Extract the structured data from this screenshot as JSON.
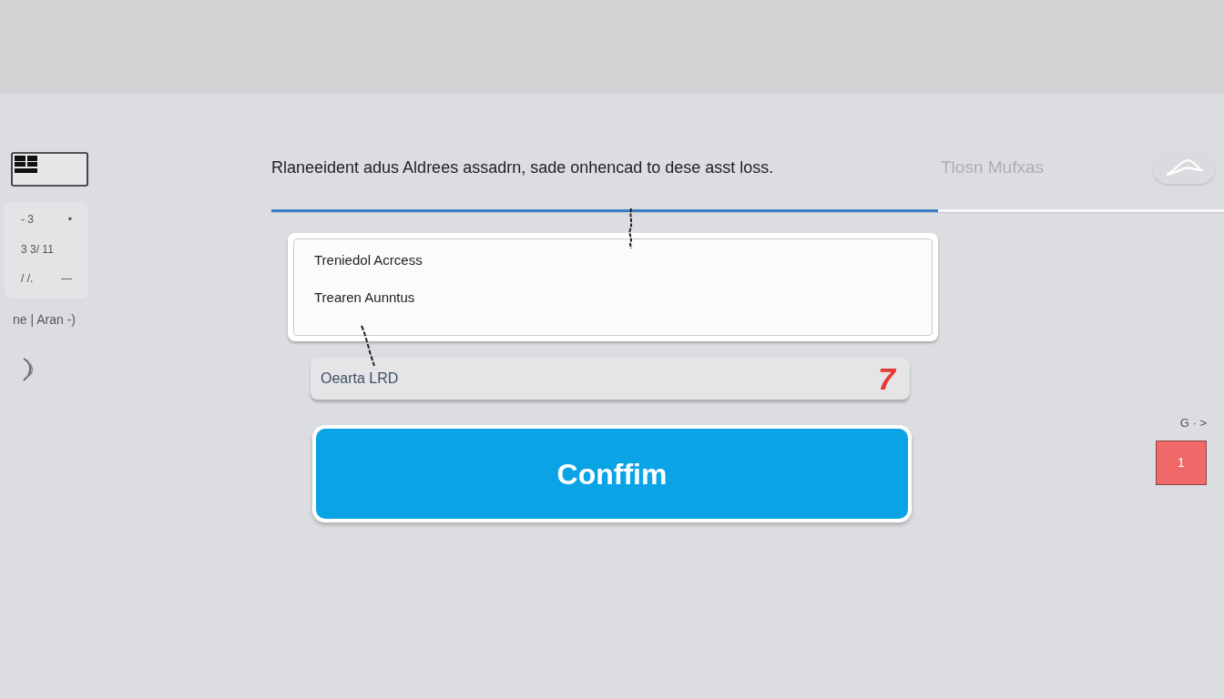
{
  "sidebar": {
    "card_rows": [
      [
        "- 3",
        "•"
      ],
      [
        "3 3/ 11"
      ],
      [
        "/ /.",
        "—"
      ]
    ],
    "caption": "ne | Aran -)"
  },
  "header": {
    "text": "Rlaneeident adus Aldrees assadrn, sade onhencad to dese asst loss.",
    "side_label": "Tlosn Mufxas"
  },
  "progress": {
    "level": 0.7
  },
  "panel": {
    "options": [
      "Treniedol Acrcess",
      "Trearen Aunntus"
    ]
  },
  "field": {
    "value": "Oearta LRD",
    "mark": "7"
  },
  "confirm_button": {
    "label": "Conffim"
  },
  "side": {
    "label": "G · >",
    "badge": "1"
  }
}
